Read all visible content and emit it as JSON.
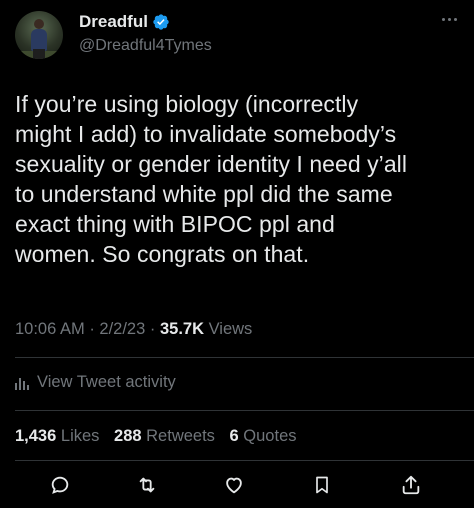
{
  "user": {
    "display_name": "Dreadful",
    "handle": "@Dreadful4Tymes",
    "verified": true
  },
  "tweet": {
    "text": "If you’re using biology (incorrectly\nmight I add) to invalidate somebody’s\nsexuality or gender identity I need y’all\nto understand white ppl did the same\nexact thing with BIPOC ppl and\nwomen. So congrats on that.",
    "time": "10:06 AM",
    "date": "2/2/23",
    "views_count": "35.7K",
    "views_label": "Views",
    "separator": "·"
  },
  "activity": {
    "label": "View Tweet activity",
    "icon": "bar-chart-icon"
  },
  "stats": {
    "likes_count": "1,436",
    "likes_label": "Likes",
    "retweets_count": "288",
    "retweets_label": "Retweets",
    "quotes_count": "6",
    "quotes_label": "Quotes"
  },
  "actions": [
    {
      "name": "reply",
      "icon": "reply-icon"
    },
    {
      "name": "retweet",
      "icon": "retweet-icon"
    },
    {
      "name": "like",
      "icon": "heart-icon"
    },
    {
      "name": "bookmark",
      "icon": "bookmark-icon"
    },
    {
      "name": "share",
      "icon": "share-icon"
    }
  ],
  "colors": {
    "background": "#000000",
    "text": "#e7e9ea",
    "secondary": "#71767b",
    "verified": "#1d9bf0",
    "divider": "#2f3336"
  }
}
